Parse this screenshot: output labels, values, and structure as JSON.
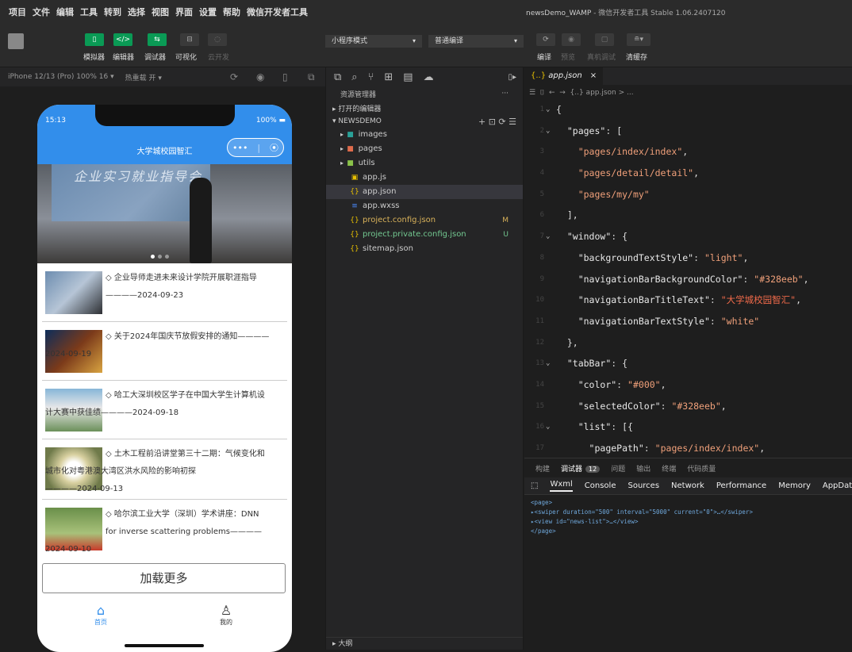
{
  "menubar": {
    "items": [
      "项目",
      "文件",
      "编辑",
      "工具",
      "转到",
      "选择",
      "视图",
      "界面",
      "设置",
      "帮助",
      "微信开发者工具"
    ],
    "title_project": "newsDemo_WAMP",
    "title_app": "微信开发者工具 Stable 1.06.2407120"
  },
  "toolbar": {
    "simulator": "模拟器",
    "editor": "编辑器",
    "debugger": "调试器",
    "visual": "可视化",
    "cloud": "云开发",
    "mode": "小程序模式",
    "compile_mode": "普通编译",
    "compile": "编译",
    "preview": "预览",
    "remote_debug": "真机调试",
    "clear_cache": "清缓存"
  },
  "simbar": {
    "device": "iPhone 12/13 (Pro) 100% 16 ▾",
    "hot_reload": "热重载 开 ▾"
  },
  "phone": {
    "time": "15:13",
    "battery": "100%",
    "nav_title": "大学城校园智汇",
    "capsule_dots": "•••",
    "swiper_text": "企业实习就业指导会",
    "news": [
      {
        "title": "◇ 企业导师走进未来设计学院开展职涯指导",
        "date": "————2024-09-23"
      },
      {
        "title": "◇ 关于2024年国庆节放假安排的通知————",
        "date": "2024-09-19"
      },
      {
        "title": "◇ 哈工大深圳校区学子在中国大学生计算机设",
        "date": "计大赛中获佳绩————2024-09-18"
      },
      {
        "title": "◇ 土木工程前沿讲堂第三十二期：气候变化和",
        "title2": "城市化对粤港澳大湾区洪水风险的影响初探",
        "date": "————2024-09-13"
      },
      {
        "title": "◇ 哈尔滨工业大学（深圳）学术讲座：DNN",
        "title2": "for inverse scattering problems————",
        "date": "2024-09-10"
      }
    ],
    "load_more": "加载更多",
    "tab_home": "首页",
    "tab_me": "我的"
  },
  "explorer": {
    "header": "资源管理器",
    "more": "···",
    "open_editors": "▸ 打开的编辑器",
    "project": "▾ NEWSDEMO",
    "actions": "+ ⊡ ⟳ ☰",
    "files": [
      {
        "name": "images",
        "icon": "▸",
        "type": "folder",
        "color": "#2aa198"
      },
      {
        "name": "pages",
        "icon": "▸",
        "type": "folder",
        "color": "#e06c4c"
      },
      {
        "name": "utils",
        "icon": "▸",
        "type": "folder",
        "color": "#8bc34a"
      },
      {
        "name": "app.js",
        "type": "js",
        "color": "#e8c000"
      },
      {
        "name": "app.json",
        "type": "json",
        "color": "#e8c000",
        "active": true
      },
      {
        "name": "app.wxss",
        "type": "wxss",
        "color": "#4a8cff"
      },
      {
        "name": "project.config.json",
        "type": "json",
        "color": "#e8c000",
        "status": "M"
      },
      {
        "name": "project.private.config.json",
        "type": "json",
        "color": "#e8c000",
        "status": "U"
      },
      {
        "name": "sitemap.json",
        "type": "json",
        "color": "#e8c000"
      }
    ],
    "outline": "▸ 大纲"
  },
  "editor": {
    "tab": "app.json",
    "close": "×",
    "breadcrumb": "{..} app.json > ...",
    "lines": [
      {
        "n": "1",
        "t": "{"
      },
      {
        "n": "2",
        "t": "  \"pages\": ["
      },
      {
        "n": "3",
        "t": "    \"pages/index/index\","
      },
      {
        "n": "4",
        "t": "    \"pages/detail/detail\","
      },
      {
        "n": "5",
        "t": "    \"pages/my/my\""
      },
      {
        "n": "6",
        "t": "  ],"
      },
      {
        "n": "7",
        "t": "  \"window\": {"
      },
      {
        "n": "8",
        "t": "    \"backgroundTextStyle\": \"light\","
      },
      {
        "n": "9",
        "t": "    \"navigationBarBackgroundColor\": \"#328eeb\","
      },
      {
        "n": "10",
        "t": "    \"navigationBarTitleText\": \"大学城校园智汇\","
      },
      {
        "n": "11",
        "t": "    \"navigationBarTextStyle\": \"white\""
      },
      {
        "n": "12",
        "t": "  },"
      },
      {
        "n": "13",
        "t": "  \"tabBar\": {"
      },
      {
        "n": "14",
        "t": "    \"color\": \"#000\","
      },
      {
        "n": "15",
        "t": "    \"selectedColor\": \"#328eeb\","
      },
      {
        "n": "16",
        "t": "    \"list\": [{"
      },
      {
        "n": "17",
        "t": "      \"pagePath\": \"pages/index/index\","
      }
    ]
  },
  "devtools": {
    "tabs1": [
      "构建",
      "调试器",
      "问题",
      "输出",
      "终端",
      "代码质量"
    ],
    "badge": "12",
    "tabs2": [
      "Wxml",
      "Console",
      "Sources",
      "Network",
      "Performance",
      "Memory",
      "AppData"
    ],
    "xml": [
      "<page>",
      "▸<swiper duration=\"500\" interval=\"5000\" current=\"0\">…</swiper>",
      "▸<view id=\"news-list\">…</view>",
      "</page>"
    ]
  },
  "colors": {
    "accent": "#328eeb",
    "green": "#0a9a55"
  }
}
